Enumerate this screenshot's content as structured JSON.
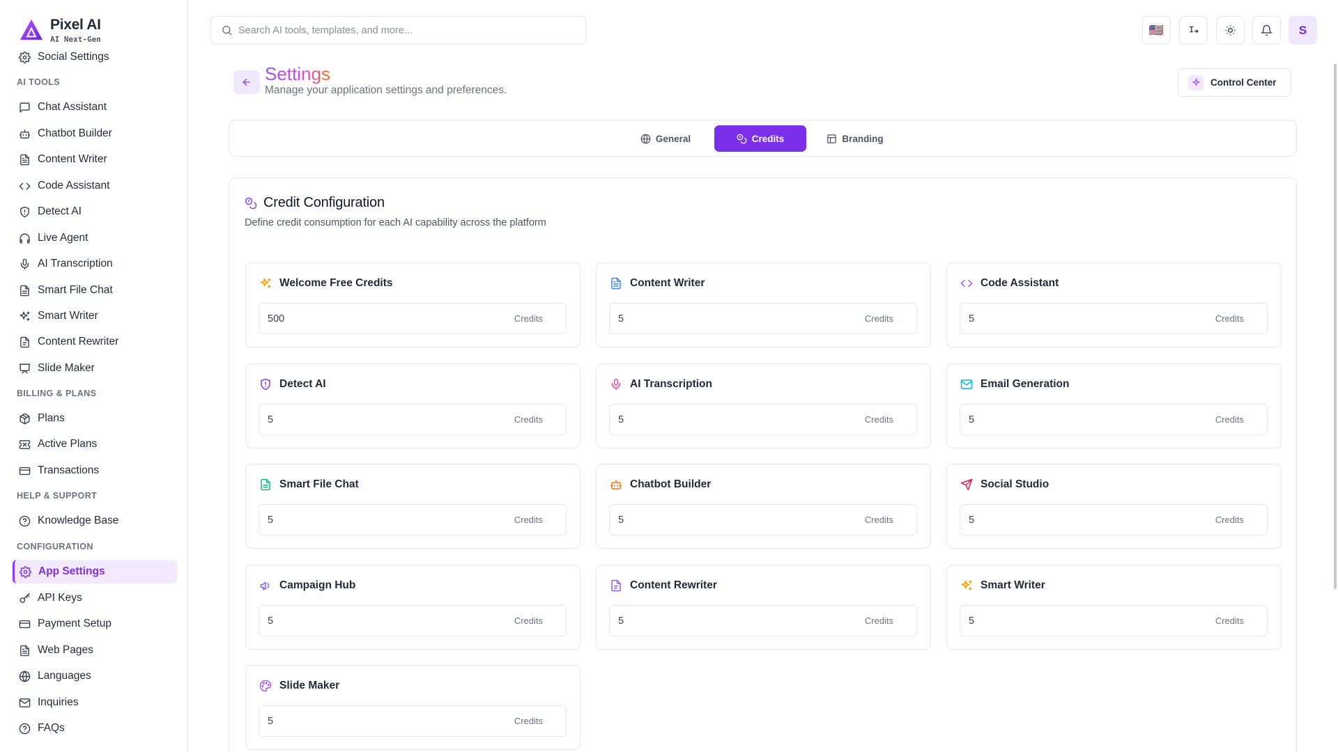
{
  "brand": {
    "name": "Pixel AI",
    "tagline": "AI Next-Gen"
  },
  "sidebar": {
    "top_items": [
      {
        "label": "Social Settings",
        "icon": "gear-icon"
      }
    ],
    "sections": [
      {
        "title": "AI TOOLS",
        "items": [
          {
            "label": "Chat Assistant",
            "icon": "message-square-icon"
          },
          {
            "label": "Chatbot Builder",
            "icon": "bot-icon"
          },
          {
            "label": "Content Writer",
            "icon": "file-text-icon"
          },
          {
            "label": "Code Assistant",
            "icon": "code-icon"
          },
          {
            "label": "Detect AI",
            "icon": "shield-icon"
          },
          {
            "label": "Live Agent",
            "icon": "headphones-icon"
          },
          {
            "label": "AI Transcription",
            "icon": "mic-icon"
          },
          {
            "label": "Smart File Chat",
            "icon": "file-icon"
          },
          {
            "label": "Smart Writer",
            "icon": "sparkles-icon"
          },
          {
            "label": "Content Rewriter",
            "icon": "file-edit-icon"
          },
          {
            "label": "Slide Maker",
            "icon": "presentation-icon"
          }
        ]
      },
      {
        "title": "BILLING & PLANS",
        "items": [
          {
            "label": "Plans",
            "icon": "package-icon"
          },
          {
            "label": "Active Plans",
            "icon": "ticket-icon"
          },
          {
            "label": "Transactions",
            "icon": "credit-card-icon"
          }
        ]
      },
      {
        "title": "HELP & SUPPORT",
        "items": [
          {
            "label": "Knowledge Base",
            "icon": "help-circle-icon"
          }
        ]
      },
      {
        "title": "CONFIGURATION",
        "items": [
          {
            "label": "App Settings",
            "icon": "gear-icon",
            "active": true
          },
          {
            "label": "API Keys",
            "icon": "key-icon"
          },
          {
            "label": "Payment Setup",
            "icon": "credit-card-icon"
          },
          {
            "label": "Web Pages",
            "icon": "file-text-icon"
          },
          {
            "label": "Languages",
            "icon": "globe-icon"
          },
          {
            "label": "Inquiries",
            "icon": "mail-icon"
          },
          {
            "label": "FAQs",
            "icon": "help-circle-icon"
          }
        ]
      }
    ]
  },
  "topbar": {
    "search_placeholder": "Search AI tools, templates, and more...",
    "flag": "🇺🇸",
    "avatar_initial": "S"
  },
  "header": {
    "title": "Settings",
    "subtitle": "Manage your application settings and preferences.",
    "control_center_label": "Control Center"
  },
  "tabs": [
    {
      "label": "General",
      "icon": "globe-icon"
    },
    {
      "label": "Credits",
      "icon": "coins-icon",
      "active": true
    },
    {
      "label": "Branding",
      "icon": "layout-icon"
    }
  ],
  "credit_config": {
    "title": "Credit Configuration",
    "subtitle": "Define credit consumption for each AI capability across the platform",
    "unit_label": "Credits",
    "items": [
      {
        "label": "Welcome Free Credits",
        "value": "500",
        "icon": "sparkles-icon",
        "color": "#f59e0b"
      },
      {
        "label": "Content Writer",
        "value": "5",
        "icon": "file-text-icon",
        "color": "#3b82f6"
      },
      {
        "label": "Code Assistant",
        "value": "5",
        "icon": "code-icon",
        "color": "#a855f7"
      },
      {
        "label": "Detect AI",
        "value": "5",
        "icon": "shield-icon",
        "color": "#7c3aed"
      },
      {
        "label": "AI Transcription",
        "value": "5",
        "icon": "mic-icon",
        "color": "#ec4899"
      },
      {
        "label": "Email Generation",
        "value": "5",
        "icon": "mail-icon",
        "color": "#06b6d4"
      },
      {
        "label": "Smart File Chat",
        "value": "5",
        "icon": "file-icon",
        "color": "#10b981"
      },
      {
        "label": "Chatbot Builder",
        "value": "5",
        "icon": "bot-icon",
        "color": "#f97316"
      },
      {
        "label": "Social Studio",
        "value": "5",
        "icon": "send-icon",
        "color": "#e11d48"
      },
      {
        "label": "Campaign Hub",
        "value": "5",
        "icon": "megaphone-icon",
        "color": "#8b5cf6"
      },
      {
        "label": "Content Rewriter",
        "value": "5",
        "icon": "file-edit-icon",
        "color": "#8b5cf6"
      },
      {
        "label": "Smart Writer",
        "value": "5",
        "icon": "sparkles-icon",
        "color": "#f59e0b"
      },
      {
        "label": "Slide Maker",
        "value": "5",
        "icon": "palette-icon",
        "color": "#a855f7"
      }
    ]
  }
}
